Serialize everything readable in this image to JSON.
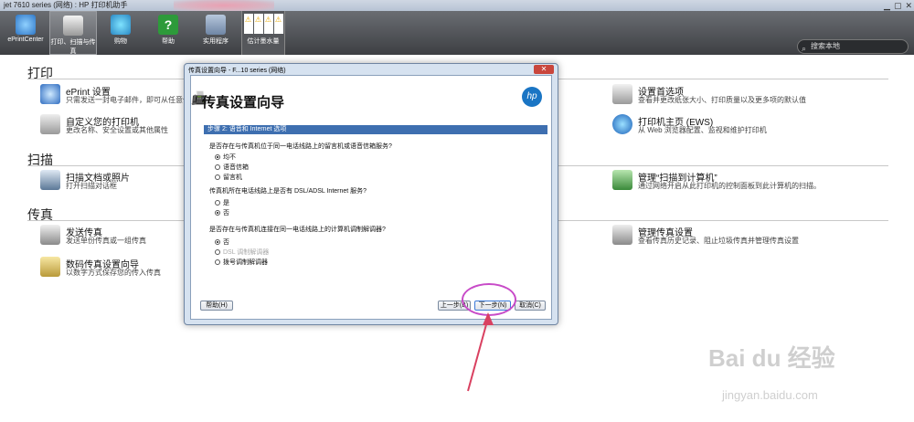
{
  "window": {
    "title": "jet 7610 series (网络) : HP 打印机助手"
  },
  "toolbar": {
    "buttons": [
      "ePrintCenter",
      "打印、扫描与传真",
      "购物",
      "帮助",
      "实用程序"
    ],
    "ink_label": "估计墨水量",
    "ink_warning": "⚠",
    "search_placeholder": "搜索本地"
  },
  "sections": {
    "print": "打印",
    "scan": "扫描",
    "fax": "传真"
  },
  "items": {
    "eprint": {
      "title": "ePrint 设置",
      "desc": "只需发送一封电子邮件，即可从任意位"
    },
    "customize": {
      "title": "自定义您的打印机",
      "desc": "更改名称、安全设置或其他属性"
    },
    "scan_doc": {
      "title": "扫描文档或照片",
      "desc": "打开扫描对话框"
    },
    "send_fax": {
      "title": "发送传真",
      "desc": "发送单份传真或一组传真"
    },
    "digital_fax": {
      "title": "数码传真设置向导",
      "desc": "以数字方式保存您的传入传真"
    },
    "prefs": {
      "title": "设置首选项",
      "desc": "查看并更改纸张大小、打印质量以及更多项的默认值"
    },
    "printer_home": {
      "title": "打印机主页 (EWS)",
      "desc": "从 Web 浏览器配置、监视和维护打印机"
    },
    "scan_to_pc": {
      "title": "管理“扫描到计算机”",
      "desc": "通过网络开启从此打印机的控制面板到此计算机的扫描。"
    },
    "fax_settings": {
      "title": "管理传真设置",
      "desc": "查看传真历史记录、阻止垃圾传真并管理传真设置"
    }
  },
  "dialog": {
    "title": "传真设置向导 - F...10 series (网络)",
    "close": "✕",
    "heading": "传真设置向导",
    "brand": "hp",
    "step": "步骤 2: 语音和 Internet 选项",
    "q1": "是否存在与传真机位于同一电话线路上的留言机或语音信箱服务?",
    "q1_options": [
      "均不",
      "语音信箱",
      "留言机"
    ],
    "q2": "传真机所在电话线路上是否有 DSL/ADSL Internet 服务?",
    "q2_options": [
      "是",
      "否"
    ],
    "q3": "是否存在与传真机连接在同一电话线路上的计算机调制解调器?",
    "q3_options": [
      "否",
      "DSL 调制解调器",
      "拨号调制解调器"
    ],
    "help_btn": "帮助(H)",
    "back_btn": "上一步(B)",
    "next_btn": "下一步(N)",
    "cancel_btn": "取消(C)"
  },
  "watermark": {
    "logo": "Bai du 经验",
    "url": "jingyan.baidu.com"
  },
  "colors": {
    "toolbar": "#4a4c50",
    "step_bar": "#3e6fb0",
    "highlight": "#c84bc8",
    "arrow": "#d94060"
  }
}
